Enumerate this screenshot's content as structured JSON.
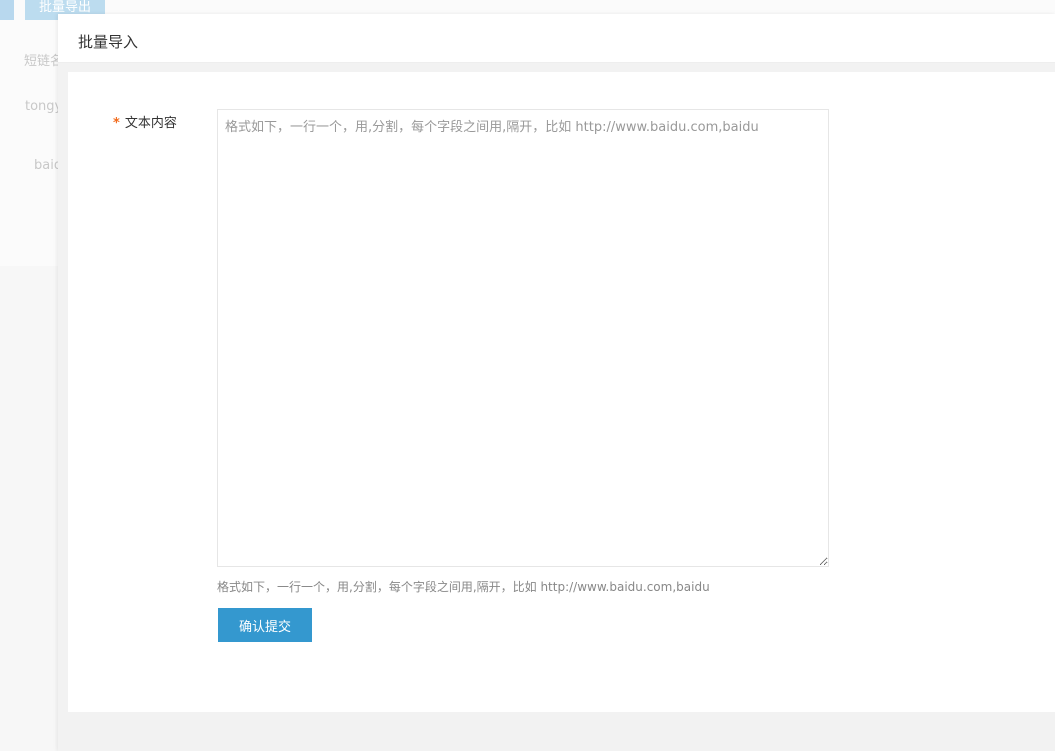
{
  "background_page": {
    "toolbar": {
      "export_button_label": "批量导出"
    },
    "table": {
      "column_header": "短链名",
      "rows": [
        "tongy",
        "baid"
      ]
    }
  },
  "modal": {
    "title": "批量导入",
    "form": {
      "content_label": "文本内容",
      "required_marker": "*",
      "textarea_value": "",
      "textarea_placeholder": "格式如下，一行一个，用,分割，每个字段之间用,隔开，比如 http://www.baidu.com,baidu",
      "help_text": "格式如下，一行一个，用,分割，每个字段之间用,隔开，比如 http://www.baidu.com,baidu",
      "submit_label": "确认提交"
    }
  },
  "colors": {
    "primary_button": "#3498cf",
    "required_marker": "#f26a1b"
  }
}
